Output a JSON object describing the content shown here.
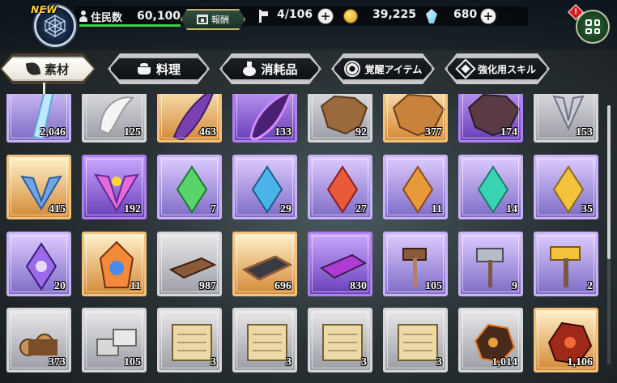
{
  "header": {
    "new_badge": "NEW",
    "resident_label": "住民数",
    "resident_value": "60,100",
    "resident_progress": 1.0,
    "reward_label": "報酬",
    "stamina_value": "4/106",
    "coins_value": "39,225",
    "crystals_value": "680",
    "alert_badge": "!"
  },
  "tabs": [
    {
      "label": "素材",
      "icon": "leaf-icon",
      "active": true
    },
    {
      "label": "料理",
      "icon": "pot-icon",
      "active": false
    },
    {
      "label": "消耗品",
      "icon": "potion-icon",
      "active": false
    },
    {
      "label": "覚醒アイテム",
      "icon": "awaken-icon",
      "active": false
    },
    {
      "label": "強化用スキル",
      "icon": "skill-icon",
      "active": false
    }
  ],
  "items": [
    {
      "qty": "2,046",
      "rarity": "purple",
      "icon": "crystal-shard-icon"
    },
    {
      "qty": "125",
      "rarity": "white",
      "icon": "white-fang-icon"
    },
    {
      "qty": "463",
      "rarity": "orange",
      "icon": "purple-horn-icon"
    },
    {
      "qty": "133",
      "rarity": "violet",
      "icon": "dark-flame-feather-icon"
    },
    {
      "qty": "92",
      "rarity": "white",
      "icon": "brown-hide-icon"
    },
    {
      "qty": "377",
      "rarity": "orange",
      "icon": "orange-pelt-icon"
    },
    {
      "qty": "174",
      "rarity": "violet",
      "icon": "dark-pelt-icon"
    },
    {
      "qty": "153",
      "rarity": "white",
      "icon": "gray-feathers-icon"
    },
    {
      "qty": "415",
      "rarity": "orange",
      "icon": "blue-feathers-icon"
    },
    {
      "qty": "192",
      "rarity": "violet",
      "icon": "rainbow-feathers-icon"
    },
    {
      "qty": "7",
      "rarity": "purple",
      "icon": "green-gem-icon"
    },
    {
      "qty": "29",
      "rarity": "purple",
      "icon": "blue-gem-icon"
    },
    {
      "qty": "27",
      "rarity": "purple",
      "icon": "red-gem-icon"
    },
    {
      "qty": "11",
      "rarity": "purple",
      "icon": "orange-gem-icon"
    },
    {
      "qty": "14",
      "rarity": "purple",
      "icon": "teal-gem-icon"
    },
    {
      "qty": "35",
      "rarity": "purple",
      "icon": "gold-gem-icon"
    },
    {
      "qty": "20",
      "rarity": "purple",
      "icon": "moon-gem-icon"
    },
    {
      "qty": "11",
      "rarity": "orange",
      "icon": "fire-crystal-icon"
    },
    {
      "qty": "987",
      "rarity": "white",
      "icon": "brown-whetstone-icon"
    },
    {
      "qty": "696",
      "rarity": "orange",
      "icon": "dark-whetstone-icon"
    },
    {
      "qty": "830",
      "rarity": "violet",
      "icon": "purple-whetstone-icon"
    },
    {
      "qty": "105",
      "rarity": "purple",
      "icon": "wood-hammer-icon"
    },
    {
      "qty": "9",
      "rarity": "purple",
      "icon": "steel-hammer-icon"
    },
    {
      "qty": "2",
      "rarity": "purple",
      "icon": "gold-hammer-icon"
    },
    {
      "qty": "373",
      "rarity": "white",
      "icon": "logs-icon"
    },
    {
      "qty": "105",
      "rarity": "white",
      "icon": "stone-blocks-icon"
    },
    {
      "qty": "3",
      "rarity": "white",
      "icon": "scroll-icon"
    },
    {
      "qty": "3",
      "rarity": "white",
      "icon": "scroll-icon"
    },
    {
      "qty": "3",
      "rarity": "white",
      "icon": "scroll-icon"
    },
    {
      "qty": "3",
      "rarity": "white",
      "icon": "scroll-icon"
    },
    {
      "qty": "1,014",
      "rarity": "white",
      "icon": "lava-ore-icon"
    },
    {
      "qty": "1,106",
      "rarity": "orange",
      "icon": "red-ore-icon"
    }
  ]
}
